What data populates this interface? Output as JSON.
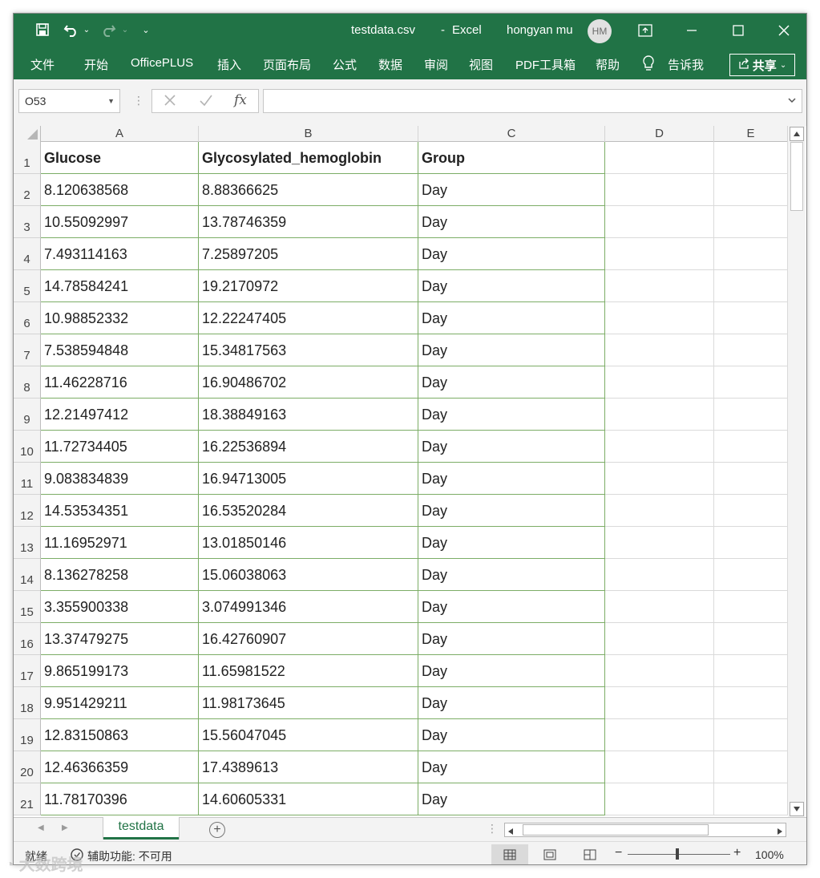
{
  "titlebar": {
    "doc_title": "testdata.csv",
    "separator": "-",
    "app_name": "Excel",
    "user_name": "hongyan mu",
    "avatar_initials": "HM",
    "accent": "#217346"
  },
  "ribbon": {
    "tabs": [
      "文件",
      "开始",
      "OfficePLUS",
      "插入",
      "页面布局",
      "公式",
      "数据",
      "审阅",
      "视图",
      "PDF工具箱",
      "帮助"
    ],
    "tell_me": "告诉我",
    "share": "共享"
  },
  "formula_bar": {
    "name_box": "O53",
    "fx_label": "fx",
    "formula": ""
  },
  "columns": [
    "A",
    "B",
    "C",
    "D",
    "E"
  ],
  "rows": [
    {
      "n": "1",
      "a": "Glucose",
      "b": "Glycosylated_hemoglobin",
      "c": "Group"
    },
    {
      "n": "2",
      "a": "8.120638568",
      "b": "8.88366625",
      "c": "Day"
    },
    {
      "n": "3",
      "a": "10.55092997",
      "b": "13.78746359",
      "c": "Day"
    },
    {
      "n": "4",
      "a": "7.493114163",
      "b": "7.25897205",
      "c": "Day"
    },
    {
      "n": "5",
      "a": "14.78584241",
      "b": "19.2170972",
      "c": "Day"
    },
    {
      "n": "6",
      "a": "10.98852332",
      "b": "12.22247405",
      "c": "Day"
    },
    {
      "n": "7",
      "a": "7.538594848",
      "b": "15.34817563",
      "c": "Day"
    },
    {
      "n": "8",
      "a": "11.46228716",
      "b": "16.90486702",
      "c": "Day"
    },
    {
      "n": "9",
      "a": "12.21497412",
      "b": "18.38849163",
      "c": "Day"
    },
    {
      "n": "10",
      "a": "11.72734405",
      "b": "16.22536894",
      "c": "Day"
    },
    {
      "n": "11",
      "a": "9.083834839",
      "b": "16.94713005",
      "c": "Day"
    },
    {
      "n": "12",
      "a": "14.53534351",
      "b": "16.53520284",
      "c": "Day"
    },
    {
      "n": "13",
      "a": "11.16952971",
      "b": "13.01850146",
      "c": "Day"
    },
    {
      "n": "14",
      "a": "8.136278258",
      "b": "15.06038063",
      "c": "Day"
    },
    {
      "n": "15",
      "a": "3.355900338",
      "b": "3.074991346",
      "c": "Day"
    },
    {
      "n": "16",
      "a": "13.37479275",
      "b": "16.42760907",
      "c": "Day"
    },
    {
      "n": "17",
      "a": "9.865199173",
      "b": "11.65981522",
      "c": "Day"
    },
    {
      "n": "18",
      "a": "9.951429211",
      "b": "11.98173645",
      "c": "Day"
    },
    {
      "n": "19",
      "a": "12.83150863",
      "b": "15.56047045",
      "c": "Day"
    },
    {
      "n": "20",
      "a": "12.46366359",
      "b": "17.4389613",
      "c": "Day"
    },
    {
      "n": "21",
      "a": "11.78170396",
      "b": "14.60605331",
      "c": "Day"
    }
  ],
  "sheets": {
    "active_tab": "testdata"
  },
  "status": {
    "ready": "就绪",
    "accessibility": "辅助功能: 不可用",
    "zoom": "100%",
    "zoom_minus": "−",
    "zoom_plus": "+"
  },
  "watermark": "大数跨境"
}
